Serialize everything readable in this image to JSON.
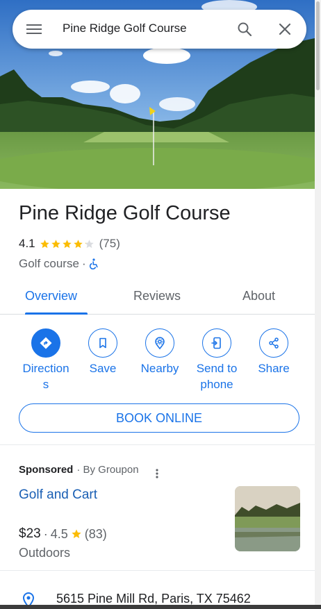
{
  "search": {
    "query": "Pine Ridge Golf Course"
  },
  "place": {
    "name": "Pine Ridge Golf Course",
    "rating": "4.1",
    "rating_value": 4.1,
    "reviews_count": "(75)",
    "category": "Golf course",
    "separator": "·"
  },
  "tabs": [
    {
      "label": "Overview",
      "active": true
    },
    {
      "label": "Reviews",
      "active": false
    },
    {
      "label": "About",
      "active": false
    }
  ],
  "actions": [
    {
      "label": "Direction s",
      "line1": "Direction",
      "line2": "s",
      "icon": "directions-icon"
    },
    {
      "label": "Save",
      "line1": "Save",
      "line2": "",
      "icon": "bookmark-icon"
    },
    {
      "label": "Nearby",
      "line1": "Nearby",
      "line2": "",
      "icon": "nearby-icon"
    },
    {
      "label": "Send to phone",
      "line1": "Send to",
      "line2": "phone",
      "icon": "send-to-phone-icon"
    },
    {
      "label": "Share",
      "line1": "Share",
      "line2": "",
      "icon": "share-icon"
    }
  ],
  "book_button": "BOOK ONLINE",
  "ad": {
    "sponsored": "Sponsored",
    "by": "· By Groupon",
    "title": "Golf and Cart",
    "price": "$23",
    "sep": "·",
    "rating": "4.5",
    "reviews": "(83)",
    "category": "Outdoors"
  },
  "address": "5615 Pine Mill Rd, Paris, TX 75462",
  "colors": {
    "accent": "#1a73e8",
    "star": "#fbbc04",
    "text": "#202124",
    "muted": "#5f6368"
  }
}
